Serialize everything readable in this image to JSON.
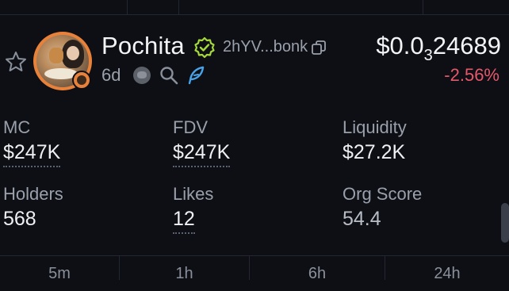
{
  "token": {
    "name": "Pochita",
    "address": "2hYV...bonk",
    "age": "6d",
    "price": {
      "prefix": "$0.0",
      "subscript": "3",
      "suffix": "24689"
    },
    "change": "-2.56%"
  },
  "stats": [
    {
      "label": "MC",
      "value": "$247K"
    },
    {
      "label": "FDV",
      "value": "$247K"
    },
    {
      "label": "Liquidity",
      "value": "$27.2K"
    },
    {
      "label": "Holders",
      "value": "568"
    },
    {
      "label": "Likes",
      "value": "12"
    },
    {
      "label": "Org Score",
      "value": "54.4"
    }
  ],
  "timeframes": [
    "5m",
    "1h",
    "6h",
    "24h"
  ],
  "colors": {
    "accent_orange": "#e8823a",
    "verified_green": "#a6d93b",
    "negative": "#e5586b",
    "feather_blue": "#4aa3e8"
  },
  "icons": [
    "star-icon",
    "verified-icon",
    "copy-icon",
    "coin-icon",
    "search-icon",
    "feather-icon"
  ]
}
